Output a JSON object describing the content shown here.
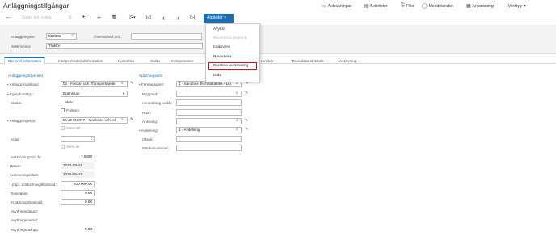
{
  "title": "Anläggningstillgångar",
  "topnav": [
    {
      "icon": "notes-icon",
      "glyph": "▭",
      "label": "Anteckningar"
    },
    {
      "icon": "activities-icon",
      "glyph": "▤",
      "label": "Aktiviteter"
    },
    {
      "icon": "files-icon",
      "glyph": "⎘",
      "label": "Filer"
    },
    {
      "icon": "notifications-icon",
      "glyph": "◯",
      "label": "Meddelanden"
    },
    {
      "icon": "customize-icon",
      "glyph": "▦",
      "label": "Anpassning"
    },
    {
      "icon": "chevron-down-icon",
      "glyph": "▾",
      "label": "Verktyg"
    }
  ],
  "toolbar": {
    "save_close": "Spara och stäng",
    "actions_label": "Åtgärder",
    "actions_chevron": "▾",
    "back_glyph": "←",
    "save_glyph": "🖫",
    "undo_glyph": "↶",
    "add_glyph": "+",
    "delete_glyph": "🗑",
    "copy_glyph": "⎘▾",
    "first_glyph": "|◁",
    "prev_glyph": "‹",
    "next_glyph": "›",
    "last_glyph": "▷|"
  },
  "summary": {
    "asset_no_label": "Anläggningsnr:",
    "asset_no_value": "000001",
    "parent_label": "Överordnad anl...",
    "parent_value": "",
    "desc_label": "Beskrivning:",
    "desc_value": "Traktor"
  },
  "tabs": [
    "Generell information",
    "Inköps-/materialinformation",
    "Kontoföra",
    "Saldo",
    "Komponenter",
    "ranskär",
    "Transaktionshistorik",
    "Avskrivning"
  ],
  "left": {
    "section": "Anläggningsöversikt",
    "class_label": "Anläggningsklass:",
    "class_value": "02 - Fordon och Transportmede",
    "ownership_label": "Egendomstyp:",
    "ownership_value": "Egenskap",
    "status_label": "Status:",
    "status_value": "Aktiv",
    "parked_label": "Parkera",
    "type_label": "Anläggningstyp:",
    "type_value": "MACHINERY - Maskiner och tel",
    "material_label": "Materiell",
    "qty_label": "Antal:",
    "qty_value": "1",
    "split_label": "Skriv av",
    "life_label": "Avskrivningstid, år:",
    "life_value": "7.0000",
    "date_label": "Datum:",
    "date_value": "2024-09-01",
    "dep_start_label": "Avskrivningsstart:",
    "dep_start_value": "2024-09-01",
    "orig_cost_label": "Urspr. anskaffningskostnad:",
    "orig_cost_value": "200 000.00",
    "restvarde_label": "Restvärde:",
    "restvarde_value": "0.00",
    "replacement_label": "Ersättningskostnad:",
    "replacement_value": "0.00",
    "dispose_date_label": "Avyttringsdatum:",
    "dispose_method_label": "Avyttringsmetod:",
    "dispose_amount_label": "Avyttringsbelopp:",
    "dispose_amount_value": "0.00"
  },
  "right": {
    "section": "Spårningsinfo",
    "company_label": "Företagsgren:",
    "company_value": "1 - Sandbox TechSolutions - Lui",
    "building_label": "Byggnad:",
    "floor_label": "Avrundning nedåt:",
    "room_label": "Rum:",
    "owner_label": "Ansvarig:",
    "dept_label": "Avdelning:",
    "dept_value": "1 - Avdelning",
    "reason_label": "Orsak:",
    "tag_label": "Märkesnummer:"
  },
  "menu": {
    "items": [
      "Avyttra",
      "Reversera avyttring",
      "Inaktivera",
      "Reversera",
      "Beräkna avskrivning",
      "Data"
    ],
    "disabled": [
      false,
      true,
      false,
      false,
      false,
      false
    ]
  }
}
